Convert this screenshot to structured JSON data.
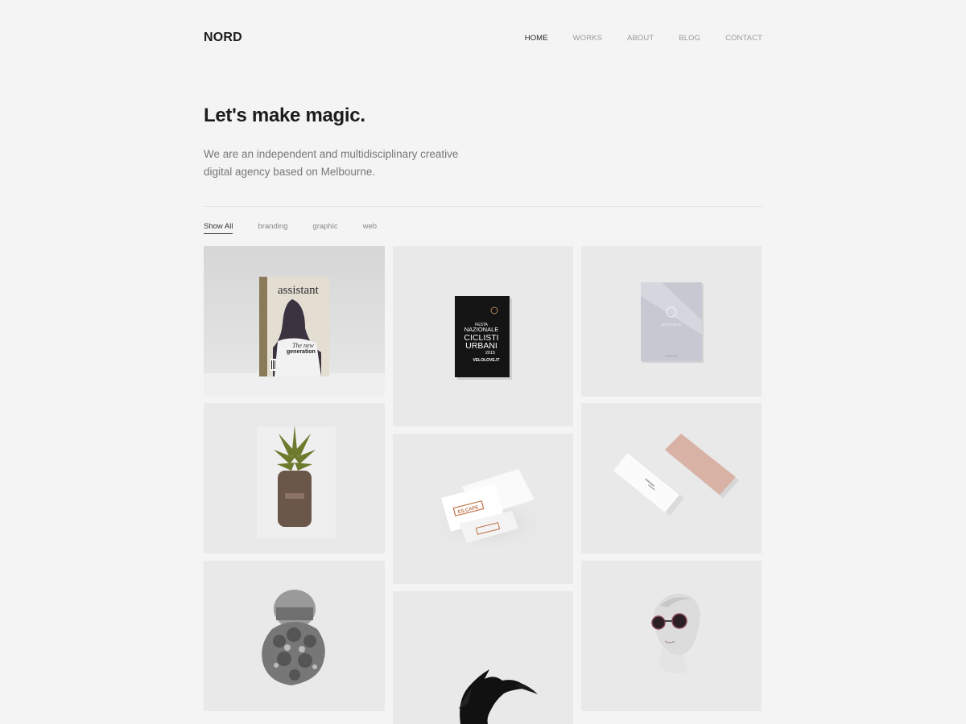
{
  "header": {
    "logo": "NORD",
    "nav": [
      {
        "label": "HOME",
        "active": true
      },
      {
        "label": "WORKS",
        "active": false
      },
      {
        "label": "ABOUT",
        "active": false
      },
      {
        "label": "BLOG",
        "active": false
      },
      {
        "label": "CONTACT",
        "active": false
      }
    ]
  },
  "hero": {
    "title": "Let's make magic.",
    "subtitle": "We are an independent and multidisciplinary creative digital agency based on Melbourne."
  },
  "filters": [
    {
      "label": "Show All",
      "active": true
    },
    {
      "label": "branding",
      "active": false
    },
    {
      "label": "graphic",
      "active": false
    },
    {
      "label": "web",
      "active": false
    }
  ],
  "portfolio": {
    "items": [
      {
        "name": "assistant-magazine",
        "texts": {
          "brand": "assistant",
          "line1": "The new",
          "line2": "generation"
        }
      },
      {
        "name": "ciclisti-urbani-poster",
        "texts": {
          "l1": "FESTA",
          "l2": "NAZIONALE",
          "l3": "CICLISTI",
          "l4": "URBANI",
          "l5": "2015",
          "l6": "VELOLOVE.IT"
        }
      },
      {
        "name": "botanical-booklet",
        "texts": {
          "brand": "BOTANICAL"
        }
      },
      {
        "name": "pineapple-bottle",
        "texts": {}
      },
      {
        "name": "escape-business-cards",
        "texts": {
          "brand": "ES.CAPE"
        }
      },
      {
        "name": "pink-business-cards",
        "texts": {}
      },
      {
        "name": "floral-portrait-collage",
        "texts": {}
      },
      {
        "name": "black-ink-splash",
        "texts": {}
      },
      {
        "name": "sunglasses-portrait",
        "texts": {}
      }
    ]
  },
  "colors": {
    "background": "#f4f4f4",
    "tile": "#e9e9e9",
    "text_primary": "#1c1c1c",
    "text_muted": "#777777",
    "accent_copper": "#c0724a",
    "card_pink": "#d9b2a6"
  }
}
